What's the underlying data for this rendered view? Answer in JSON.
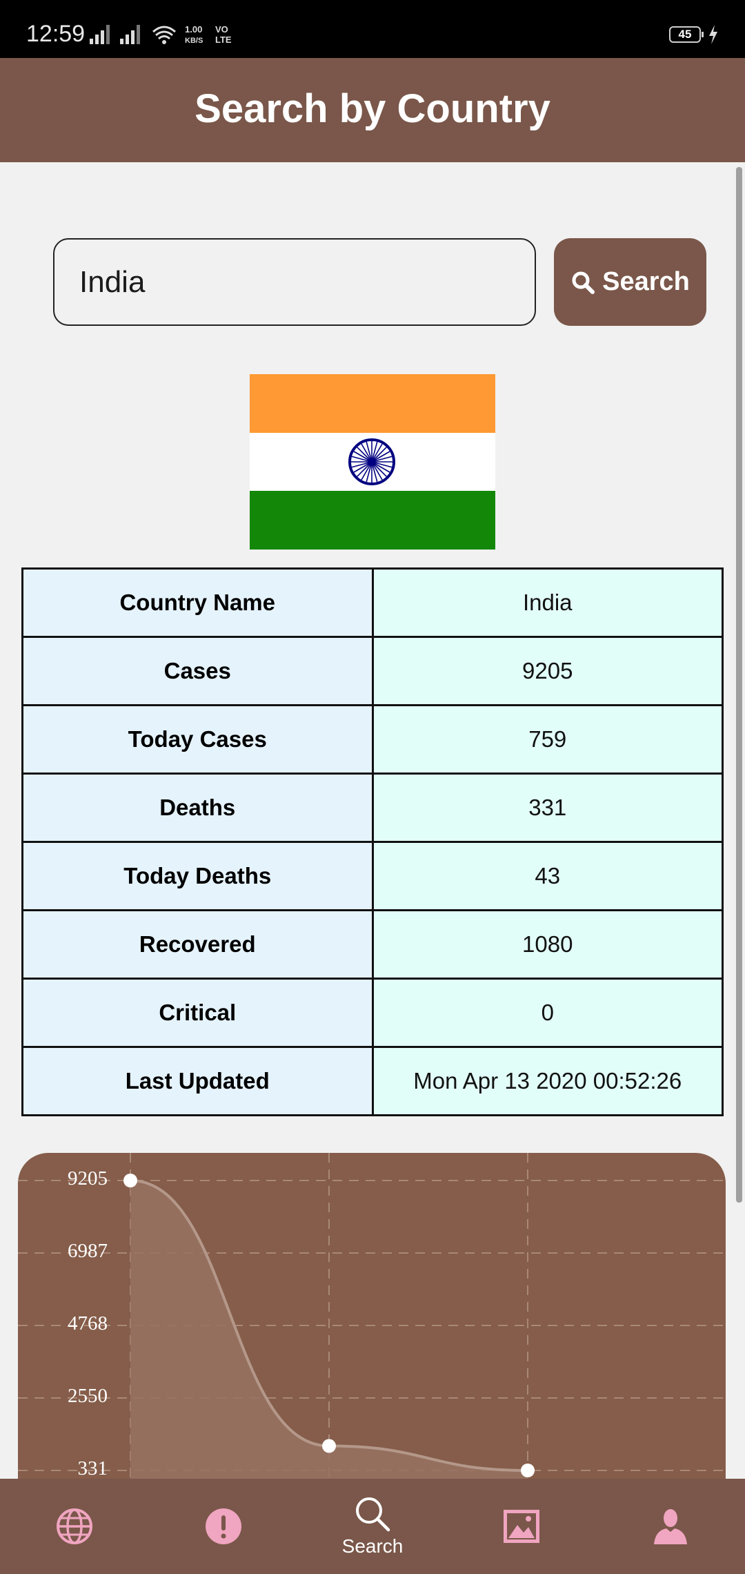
{
  "status_bar": {
    "time": "12:59",
    "network_speed": "1.00 KB/S",
    "network_type": "VO LTE",
    "battery": "45"
  },
  "header": {
    "title": "Search by Country"
  },
  "search": {
    "input_value": "India",
    "button_label": "Search"
  },
  "country": {
    "flag": "india-flag",
    "table": [
      {
        "label": "Country Name",
        "value": "India"
      },
      {
        "label": "Cases",
        "value": "9205"
      },
      {
        "label": "Today Cases",
        "value": "759"
      },
      {
        "label": "Deaths",
        "value": "331"
      },
      {
        "label": "Today Deaths",
        "value": "43"
      },
      {
        "label": "Recovered",
        "value": "1080"
      },
      {
        "label": "Critical",
        "value": "0"
      },
      {
        "label": "Last Updated",
        "value": "Mon Apr 13 2020 00:52:26"
      }
    ]
  },
  "chart_data": {
    "type": "area",
    "y_ticks": [
      "9205",
      "6987",
      "4768",
      "2550",
      "331"
    ],
    "ylim": [
      331,
      9205
    ],
    "values": [
      9205,
      1080,
      331
    ],
    "colors": {
      "background": "#855d4a",
      "area": "#987262",
      "line": "#b4988a",
      "point": "#ffffff",
      "grid": "#a98877"
    }
  },
  "bottom_nav": {
    "items": [
      {
        "icon": "globe-icon",
        "label": ""
      },
      {
        "icon": "alert-icon",
        "label": ""
      },
      {
        "icon": "search-icon",
        "label": "Search",
        "active": true
      },
      {
        "icon": "image-icon",
        "label": ""
      },
      {
        "icon": "person-icon",
        "label": ""
      }
    ]
  },
  "colors": {
    "primary": "#7a574a",
    "nav_icon": "#f0a5c0",
    "label_cell": "#e5f3fd",
    "value_cell": "#e2fef8"
  }
}
